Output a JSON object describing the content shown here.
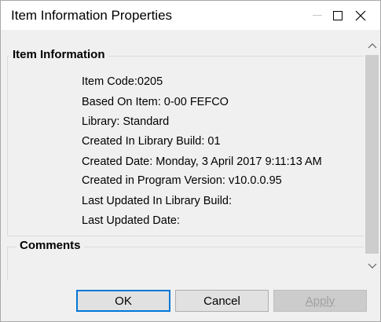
{
  "window": {
    "title": "Item Information Properties"
  },
  "groups": {
    "info_label": "Item Information",
    "comments_label": "Comments"
  },
  "item_info": {
    "lines": [
      "Item Code:0205",
      "Based On Item: 0-00 FEFCO",
      "Library: Standard",
      "Created In Library Build: 01",
      "Created Date: Monday, 3 April 2017 9:11:13 AM",
      "Created in Program Version: v10.0.0.95",
      "Last Updated In Library Build:",
      "Last Updated Date:"
    ]
  },
  "comments": {
    "value": ""
  },
  "buttons": {
    "ok": "OK",
    "cancel": "Cancel",
    "apply": "Apply"
  },
  "icons": {
    "minimize": "minimize-icon",
    "maximize": "maximize-icon",
    "close": "close-icon",
    "scroll_up": "chevron-up-icon",
    "scroll_down": "chevron-down-icon"
  },
  "colors": {
    "focus_border": "#0078d7",
    "disabled_text": "#a0a0a0"
  }
}
